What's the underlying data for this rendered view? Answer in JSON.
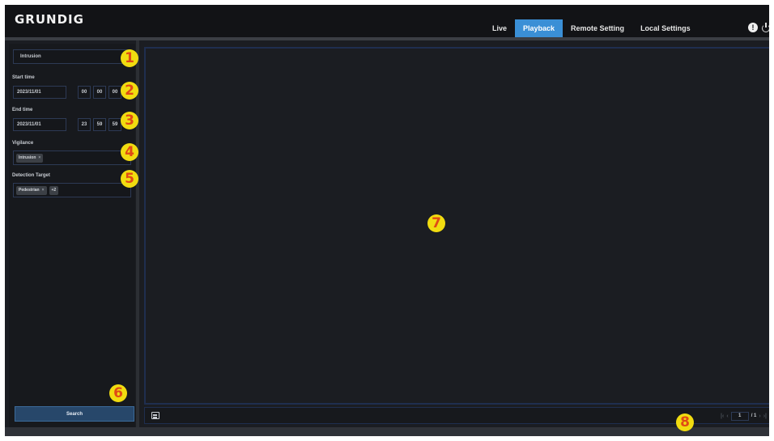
{
  "brand": {
    "logo_text": "GRUNDIG"
  },
  "nav": {
    "tabs": [
      {
        "label": "Live",
        "active": false
      },
      {
        "label": "Playback",
        "active": true
      },
      {
        "label": "Remote Setting",
        "active": false
      },
      {
        "label": "Local Settings",
        "active": false
      }
    ],
    "accent_color": "#3a8fd6",
    "icons": [
      "info-icon",
      "power-icon"
    ]
  },
  "sidebar": {
    "event_type": {
      "value": "Intrusion"
    },
    "start_time": {
      "label": "Start time",
      "date": "2023/11/01",
      "hour": "00",
      "minute": "00",
      "second": "00"
    },
    "end_time": {
      "label": "End time",
      "date": "2023/11/01",
      "hour": "23",
      "minute": "59",
      "second": "59"
    },
    "vigilance": {
      "label": "Vigilance",
      "chips": [
        "Intrusion"
      ]
    },
    "detection_target": {
      "label": "Detection Target",
      "chips": [
        "Pedestrian"
      ],
      "more": "+2"
    },
    "search_button": {
      "label": "Search"
    }
  },
  "badges": [
    "1",
    "2",
    "3",
    "4",
    "5",
    "6",
    "7",
    "8"
  ],
  "badge_colors": {
    "fill": "#f1dc10",
    "text": "#e04a16"
  },
  "pager": {
    "current": "1",
    "total": "/ 1"
  }
}
